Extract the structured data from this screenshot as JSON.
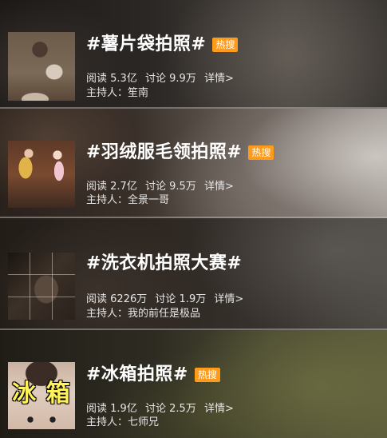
{
  "topics": [
    {
      "title": "#薯片袋拍照#",
      "badge": "热搜",
      "read_label": "阅读",
      "read_value": "5.3亿",
      "discuss_label": "讨论",
      "discuss_value": "9.9万",
      "details": "详情>",
      "host_label": "主持人：",
      "host_name": "笙南"
    },
    {
      "title": "#羽绒服毛领拍照#",
      "badge": "热搜",
      "read_label": "阅读",
      "read_value": "2.7亿",
      "discuss_label": "讨论",
      "discuss_value": "9.5万",
      "details": "详情>",
      "host_label": "主持人：",
      "host_name": "全景一哥"
    },
    {
      "title": "#洗衣机拍照大赛#",
      "read_label": "阅读",
      "read_value": "6226万",
      "discuss_label": "讨论",
      "discuss_value": "1.9万",
      "details": "详情>",
      "host_label": "主持人：",
      "host_name": "我的前任是极品"
    },
    {
      "title": "#冰箱拍照#",
      "badge": "热搜",
      "thumb_text": "冰 箱",
      "read_label": "阅读",
      "read_value": "1.9亿",
      "discuss_label": "讨论",
      "discuss_value": "2.5万",
      "details": "详情>",
      "host_label": "主持人：",
      "host_name": "七师兄"
    }
  ],
  "colors": {
    "badge_bg": "#ff9b1a",
    "title_text": "#ffffff",
    "meta_text": "#e6e6e6"
  }
}
